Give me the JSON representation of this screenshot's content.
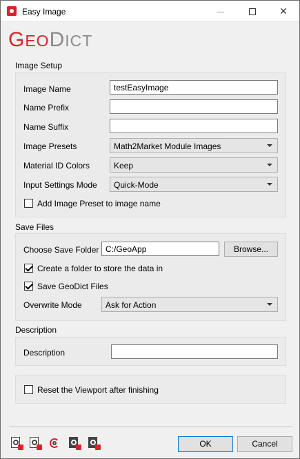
{
  "window": {
    "title": "Easy Image",
    "controls": {
      "minimize": "",
      "maximize": "",
      "close": "✕"
    }
  },
  "logo": {
    "part1_big": "G",
    "part1_small": "EO",
    "part2_big": "D",
    "part2_small": "ICT"
  },
  "image_setup": {
    "section_title": "Image Setup",
    "image_name_label": "Image Name",
    "image_name_value": "testEasyImage",
    "name_prefix_label": "Name Prefix",
    "name_prefix_value": "",
    "name_suffix_label": "Name Suffix",
    "name_suffix_value": "",
    "image_presets_label": "Image Presets",
    "image_presets_value": "Math2Market Module Images",
    "material_id_colors_label": "Material ID Colors",
    "material_id_colors_value": "Keep",
    "input_settings_mode_label": "Input Settings Mode",
    "input_settings_mode_value": "Quick-Mode",
    "add_preset_label": "Add Image Preset to image name",
    "add_preset_checked": false
  },
  "save_files": {
    "section_title": "Save Files",
    "choose_folder_label": "Choose Save Folder",
    "folder_value": "C:/GeoApp",
    "browse_label": "Browse...",
    "create_folder_label": "Create a folder to store the data in",
    "create_folder_checked": true,
    "save_geodict_label": "Save GeoDict Files",
    "save_geodict_checked": true,
    "overwrite_mode_label": "Overwrite Mode",
    "overwrite_mode_value": "Ask for Action"
  },
  "description": {
    "section_title": "Description",
    "description_label": "Description",
    "description_value": ""
  },
  "viewport": {
    "reset_label": "Reset the Viewport after finishing",
    "reset_checked": false
  },
  "footer": {
    "ok_label": "OK",
    "cancel_label": "Cancel",
    "tool_icons": [
      "load-settings-icon",
      "save-settings-icon",
      "reset-icon",
      "export-settings-icon",
      "delete-settings-icon"
    ]
  },
  "colors": {
    "brand_red": "#d8232a",
    "brand_gray": "#8a8a8a"
  }
}
